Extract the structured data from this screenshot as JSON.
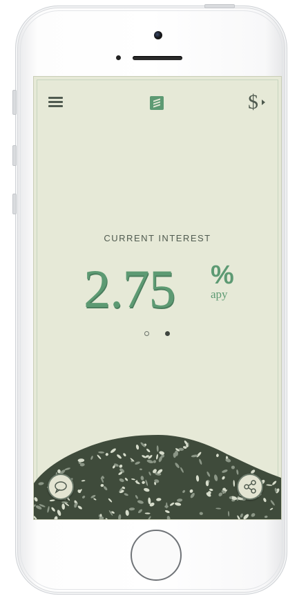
{
  "header": {
    "menu_icon": "hamburger-menu-icon",
    "logo_icon": "app-logo-icon",
    "currency_icon": "dollar-menu-icon"
  },
  "main": {
    "label": "CURRENT INTEREST",
    "rate": "2.75",
    "percent_sign": "%",
    "unit": "apy",
    "pager": {
      "count": 2,
      "active_index": 1
    }
  },
  "footer": {
    "chat_icon": "chat-bubble-icon",
    "share_icon": "share-icon"
  },
  "colors": {
    "background": "#e6e9d7",
    "accent": "#5d9a73",
    "text": "#4f5a4f",
    "coins_dark": "#3f4b3b"
  }
}
